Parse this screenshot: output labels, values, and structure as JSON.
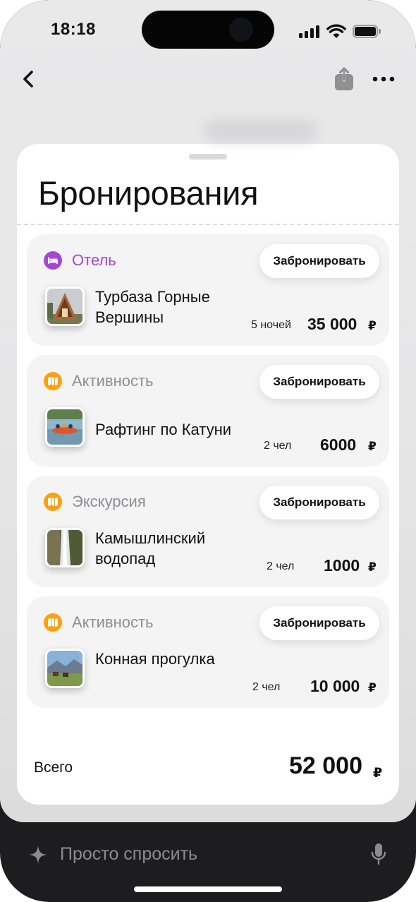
{
  "status_bar": {
    "time": "18:18",
    "icons": [
      "signal-icon",
      "wifi-icon",
      "battery-icon"
    ]
  },
  "nav": {
    "back_icon": "chevron-left-icon",
    "share_icon": "share-icon",
    "more_icon": "more-icon"
  },
  "sheet": {
    "title": "Бронирования",
    "book_label": "Забронировать",
    "items": [
      {
        "category": "Отель",
        "category_icon": "bed-icon",
        "category_color": "#a347d8",
        "name": "Турбаза Горные Вершины",
        "quantity": "5 ночей",
        "price": "35 000",
        "currency": "₽"
      },
      {
        "category": "Активность",
        "category_icon": "map-icon",
        "category_color": "#ff9f0a",
        "name": "Рафтинг по Катуни",
        "quantity": "2 чел",
        "price": "6000",
        "currency": "₽"
      },
      {
        "category": "Экскурсия",
        "category_icon": "map-icon",
        "category_color": "#ff9f0a",
        "name": "Камышлинский водопад",
        "quantity": "2 чел",
        "price": "1000",
        "currency": "₽"
      },
      {
        "category": "Активность",
        "category_icon": "map-icon",
        "category_color": "#ff9f0a",
        "name": "Конная прогулка",
        "quantity": "2 чел",
        "price": "10 000",
        "currency": "₽"
      }
    ],
    "total": {
      "label": "Всего",
      "value": "52 000",
      "currency": "₽"
    }
  },
  "ask_bar": {
    "placeholder": "Просто спросить",
    "sparkle_icon": "sparkle-icon",
    "mic_icon": "microphone-icon"
  },
  "colors": {
    "hotel_accent": "#a347d8",
    "activity_accent": "#ff9f0a",
    "category_gray": "#8e8e93",
    "bottom_bar": "#1d1d1f"
  }
}
